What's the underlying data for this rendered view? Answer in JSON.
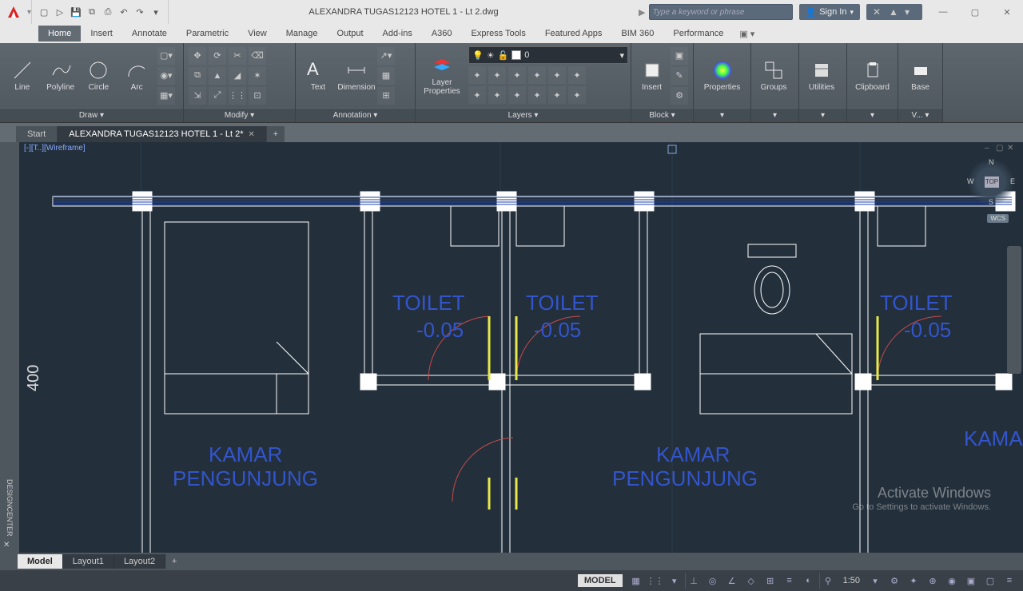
{
  "titlebar": {
    "filename": "ALEXANDRA TUGAS12123 HOTEL 1 - Lt  2.dwg",
    "search_placeholder": "Type a keyword or phrase",
    "signin": "Sign In"
  },
  "ribbon_tabs": [
    "Home",
    "Insert",
    "Annotate",
    "Parametric",
    "View",
    "Manage",
    "Output",
    "Add-ins",
    "A360",
    "Express Tools",
    "Featured Apps",
    "BIM 360",
    "Performance"
  ],
  "ribbon_active": 0,
  "panels": {
    "draw": {
      "title": "Draw ▾",
      "buttons": [
        "Line",
        "Polyline",
        "Circle",
        "Arc"
      ]
    },
    "modify": {
      "title": "Modify ▾"
    },
    "annotation": {
      "title": "Annotation ▾",
      "buttons": [
        "Text",
        "Dimension"
      ]
    },
    "layers": {
      "title": "Layers ▾",
      "big": "Layer\nProperties",
      "combo": "0"
    },
    "block": {
      "title": "Block ▾",
      "big": "Insert"
    },
    "properties": {
      "title": "▾",
      "big": "Properties"
    },
    "groups": {
      "title": "▾",
      "big": "Groups"
    },
    "utilities": {
      "title": "▾",
      "big": "Utilities"
    },
    "clipboard": {
      "title": "▾",
      "big": "Clipboard"
    },
    "base": {
      "title": "V... ▾",
      "big": "Base"
    }
  },
  "file_tabs": {
    "start": "Start",
    "active": "ALEXANDRA TUGAS12123 HOTEL 1 - Lt  2*"
  },
  "view": {
    "wireframe": "[-][T..][Wireframe]",
    "cube": {
      "top": "TOP",
      "n": "N",
      "s": "S",
      "e": "E",
      "w": "W"
    },
    "wcs": "WCS"
  },
  "drawing_text": {
    "toilet": "TOILET",
    "toilet_lvl": "-0.05",
    "kamar": "KAMAR",
    "pengunjung": "PENGUNJUNG",
    "dim400": "400"
  },
  "model_tabs": [
    "Model",
    "Layout1",
    "Layout2"
  ],
  "model_active": 0,
  "status": {
    "model": "MODEL",
    "scale": "1:50"
  },
  "watermark": {
    "title": "Activate Windows",
    "sub": "Go to Settings to activate Windows."
  },
  "left_bar": "DESIGNCENTER"
}
